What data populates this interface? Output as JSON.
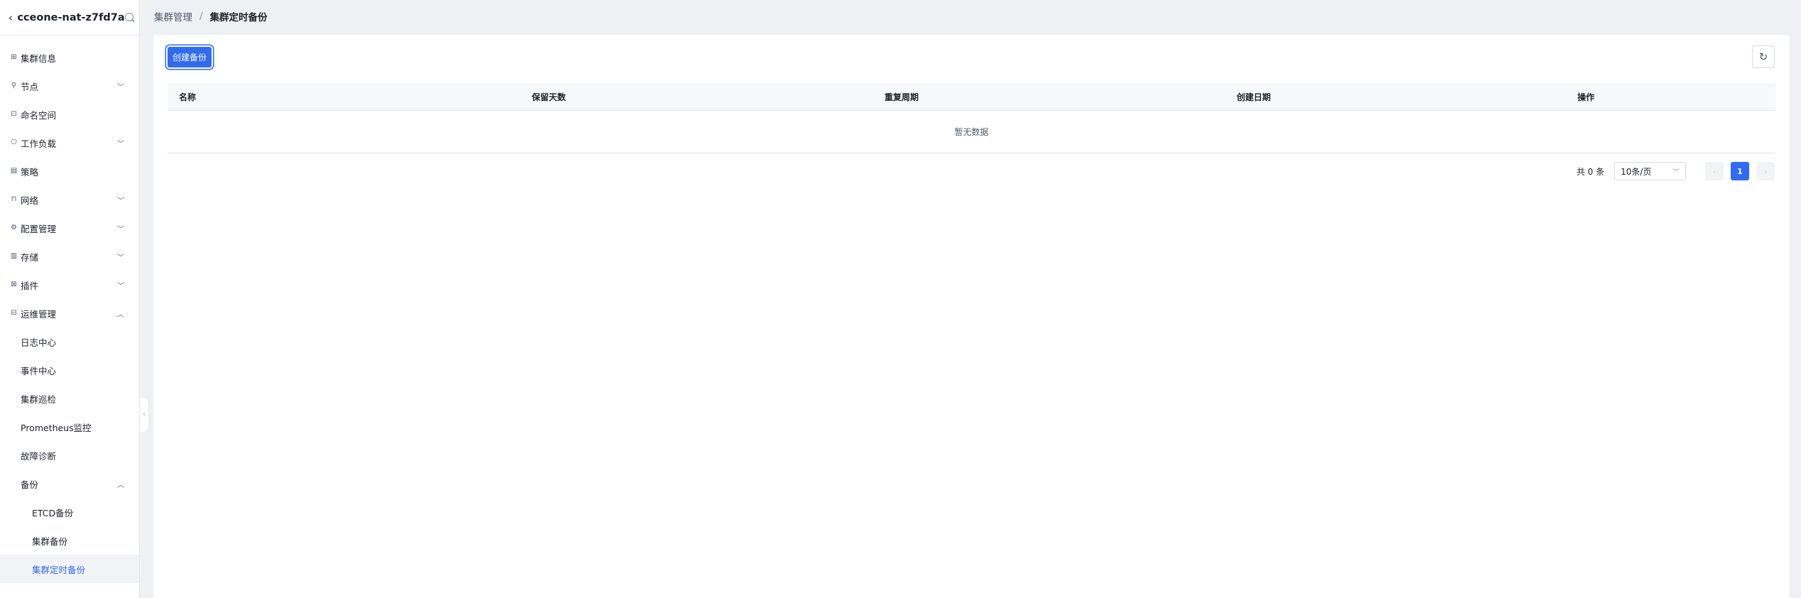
{
  "sidebar": {
    "title": "cceone-nat-z7fd7a",
    "items": [
      {
        "label": "集群信息",
        "icon": "grid-icon",
        "glyph": "⊞",
        "chevron": ""
      },
      {
        "label": "节点",
        "icon": "node-icon",
        "glyph": "⚲",
        "chevron": "﹀"
      },
      {
        "label": "命名空间",
        "icon": "namespace-icon",
        "glyph": "⊡",
        "chevron": ""
      },
      {
        "label": "工作负载",
        "icon": "workload-icon",
        "glyph": "⎔",
        "chevron": "﹀"
      },
      {
        "label": "策略",
        "icon": "policy-icon",
        "glyph": "▤",
        "chevron": ""
      },
      {
        "label": "网络",
        "icon": "network-icon",
        "glyph": "⊓",
        "chevron": "﹀"
      },
      {
        "label": "配置管理",
        "icon": "config-icon",
        "glyph": "⚙",
        "chevron": "﹀"
      },
      {
        "label": "存储",
        "icon": "storage-icon",
        "glyph": "▥",
        "chevron": "﹀"
      },
      {
        "label": "插件",
        "icon": "plugin-icon",
        "glyph": "⊠",
        "chevron": "﹀"
      },
      {
        "label": "运维管理",
        "icon": "ops-icon",
        "glyph": "⊟",
        "chevron": "︿"
      }
    ],
    "ops_children": [
      "日志中心",
      "事件中心",
      "集群巡检",
      "Prometheus监控",
      "故障诊断"
    ],
    "backup": {
      "label": "备份",
      "chevron": "︿"
    },
    "backup_children": [
      "ETCD备份",
      "集群备份",
      "集群定时备份"
    ],
    "collapse_glyph": "‹",
    "back_glyph": "‹"
  },
  "breadcrumb": {
    "parent": "集群管理",
    "separator": "/",
    "current": "集群定时备份"
  },
  "toolbar": {
    "create_label": "创建备份",
    "refresh_glyph": "↻"
  },
  "table": {
    "columns": [
      "名称",
      "保留天数",
      "重复周期",
      "创建日期",
      "操作"
    ],
    "rows": [],
    "empty_text": "暂无数据"
  },
  "pagination": {
    "total": "共 0 条",
    "page_size": "10条/页",
    "current_page": "1",
    "prev_glyph": "‹",
    "next_glyph": "›",
    "select_arrow": "﹀"
  },
  "colors": {
    "accent": "#2f6bf5",
    "background": "#eef0f3"
  }
}
